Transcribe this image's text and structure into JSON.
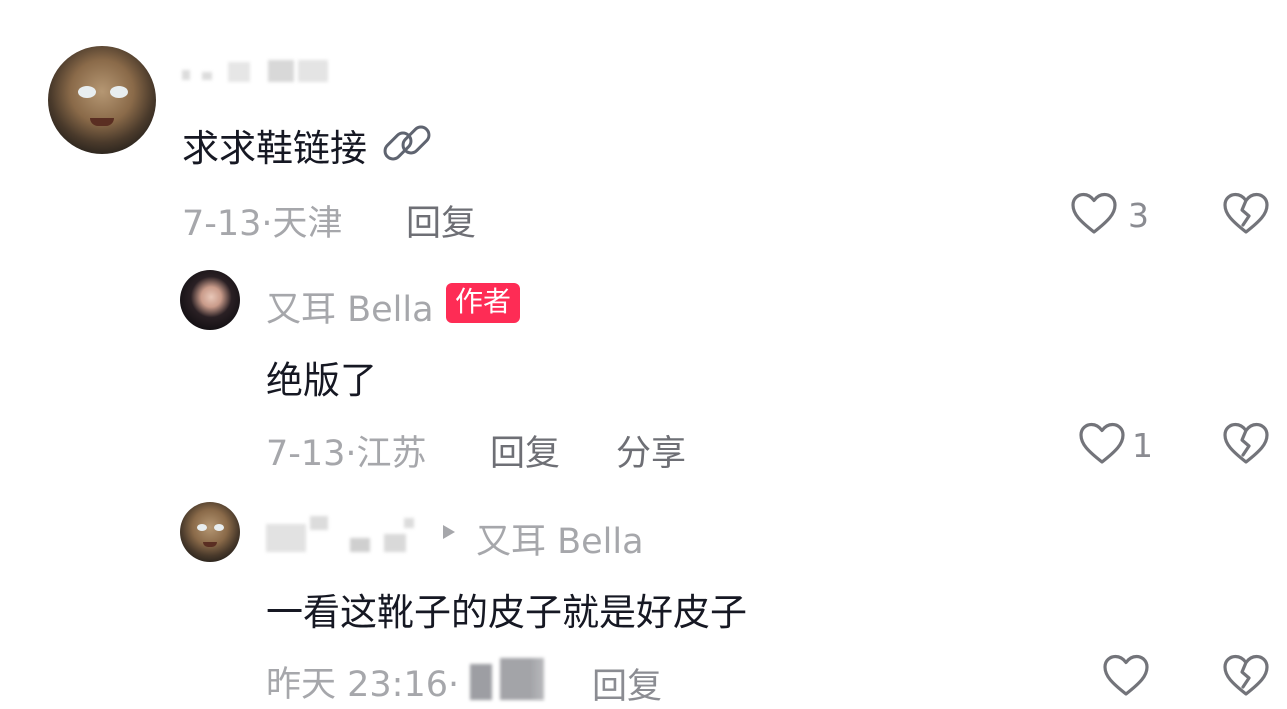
{
  "comments": [
    {
      "text": "求求鞋链接",
      "text_icon": "link-icon",
      "date_location": "7-13·天津",
      "reply_label": "回复",
      "likes": "3"
    },
    {
      "author": "又耳 Bella",
      "author_badge": "作者",
      "text": "绝版了",
      "date_location": "7-13·江苏",
      "reply_label": "回复",
      "share_label": "分享",
      "likes": "1"
    },
    {
      "reply_to": "又耳 Bella",
      "text": "一看这靴子的皮子就是好皮子",
      "date_location": "昨天 23:16·",
      "reply_label": "回复"
    }
  ],
  "icons": {
    "like": "heart-outline-icon",
    "dislike": "broken-heart-icon",
    "reply_arrow": "triangle-right-icon"
  },
  "colors": {
    "badge_bg": "#fe2c55",
    "meta_text": "#a6a7ab",
    "primary_text": "#161823"
  }
}
